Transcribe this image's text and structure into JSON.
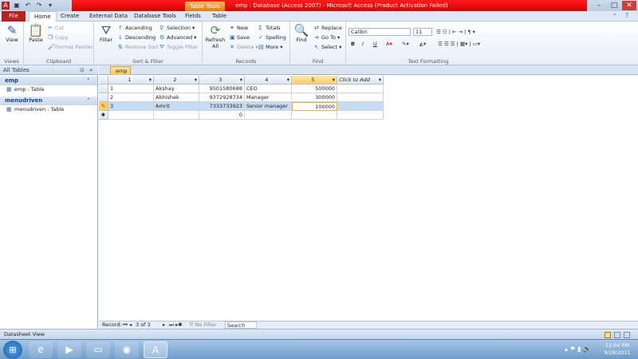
{
  "window": {
    "title": "emp : Database (Access 2007) - Microsoft Access (Product Activation Failed)",
    "context_tab": "Table Tools"
  },
  "tabs": [
    "File",
    "Home",
    "Create",
    "External Data",
    "Database Tools",
    "Fields",
    "Table"
  ],
  "ribbon": {
    "views": {
      "label": "Views",
      "view_btn": "View"
    },
    "clipboard": {
      "label": "Clipboard",
      "paste": "Paste",
      "cut": "Cut",
      "copy": "Copy",
      "format_painter": "Format Painter"
    },
    "sort_filter": {
      "label": "Sort & Filter",
      "filter": "Filter",
      "ascending": "Ascending",
      "descending": "Descending",
      "remove_sort": "Remove Sort",
      "selection": "Selection",
      "advanced": "Advanced",
      "toggle_filter": "Toggle Filter"
    },
    "records": {
      "label": "Records",
      "refresh": "Refresh All",
      "new": "New",
      "save": "Save",
      "delete": "Delete",
      "totals": "Totals",
      "spelling": "Spelling",
      "more": "More"
    },
    "find": {
      "label": "Find",
      "find": "Find",
      "replace": "Replace",
      "goto": "Go To",
      "select": "Select"
    },
    "text_formatting": {
      "label": "Text Formatting",
      "font": "Calibri",
      "size": "11",
      "bold": "B",
      "italic": "I",
      "underline": "U"
    }
  },
  "nav_pane": {
    "title": "All Tables",
    "groups": [
      {
        "name": "emp",
        "items": [
          "emp : Table"
        ]
      },
      {
        "name": "menudriven",
        "items": [
          "menudriven : Table"
        ]
      }
    ]
  },
  "doc_tab": "emp",
  "grid": {
    "columns": [
      "1",
      "2",
      "3",
      "4",
      "5",
      "Click to Add"
    ],
    "rows": [
      [
        "1",
        "Akshay",
        "9501580688",
        "CEO",
        "500000"
      ],
      [
        "2",
        "Abhishek",
        "9372928734",
        "Manager",
        "300000"
      ],
      [
        "3",
        "Amrit",
        "7333733923",
        "Senior manager",
        "100000"
      ],
      [
        "",
        "",
        "0",
        "",
        ""
      ]
    ]
  },
  "record_nav": {
    "label": "Record:",
    "position": "3 of 3",
    "filter": "No Filter",
    "search": "Search"
  },
  "status": {
    "text": "Datasheet View"
  },
  "taskbar": {
    "time": "11:04 PM",
    "date": "9/28/2011"
  }
}
